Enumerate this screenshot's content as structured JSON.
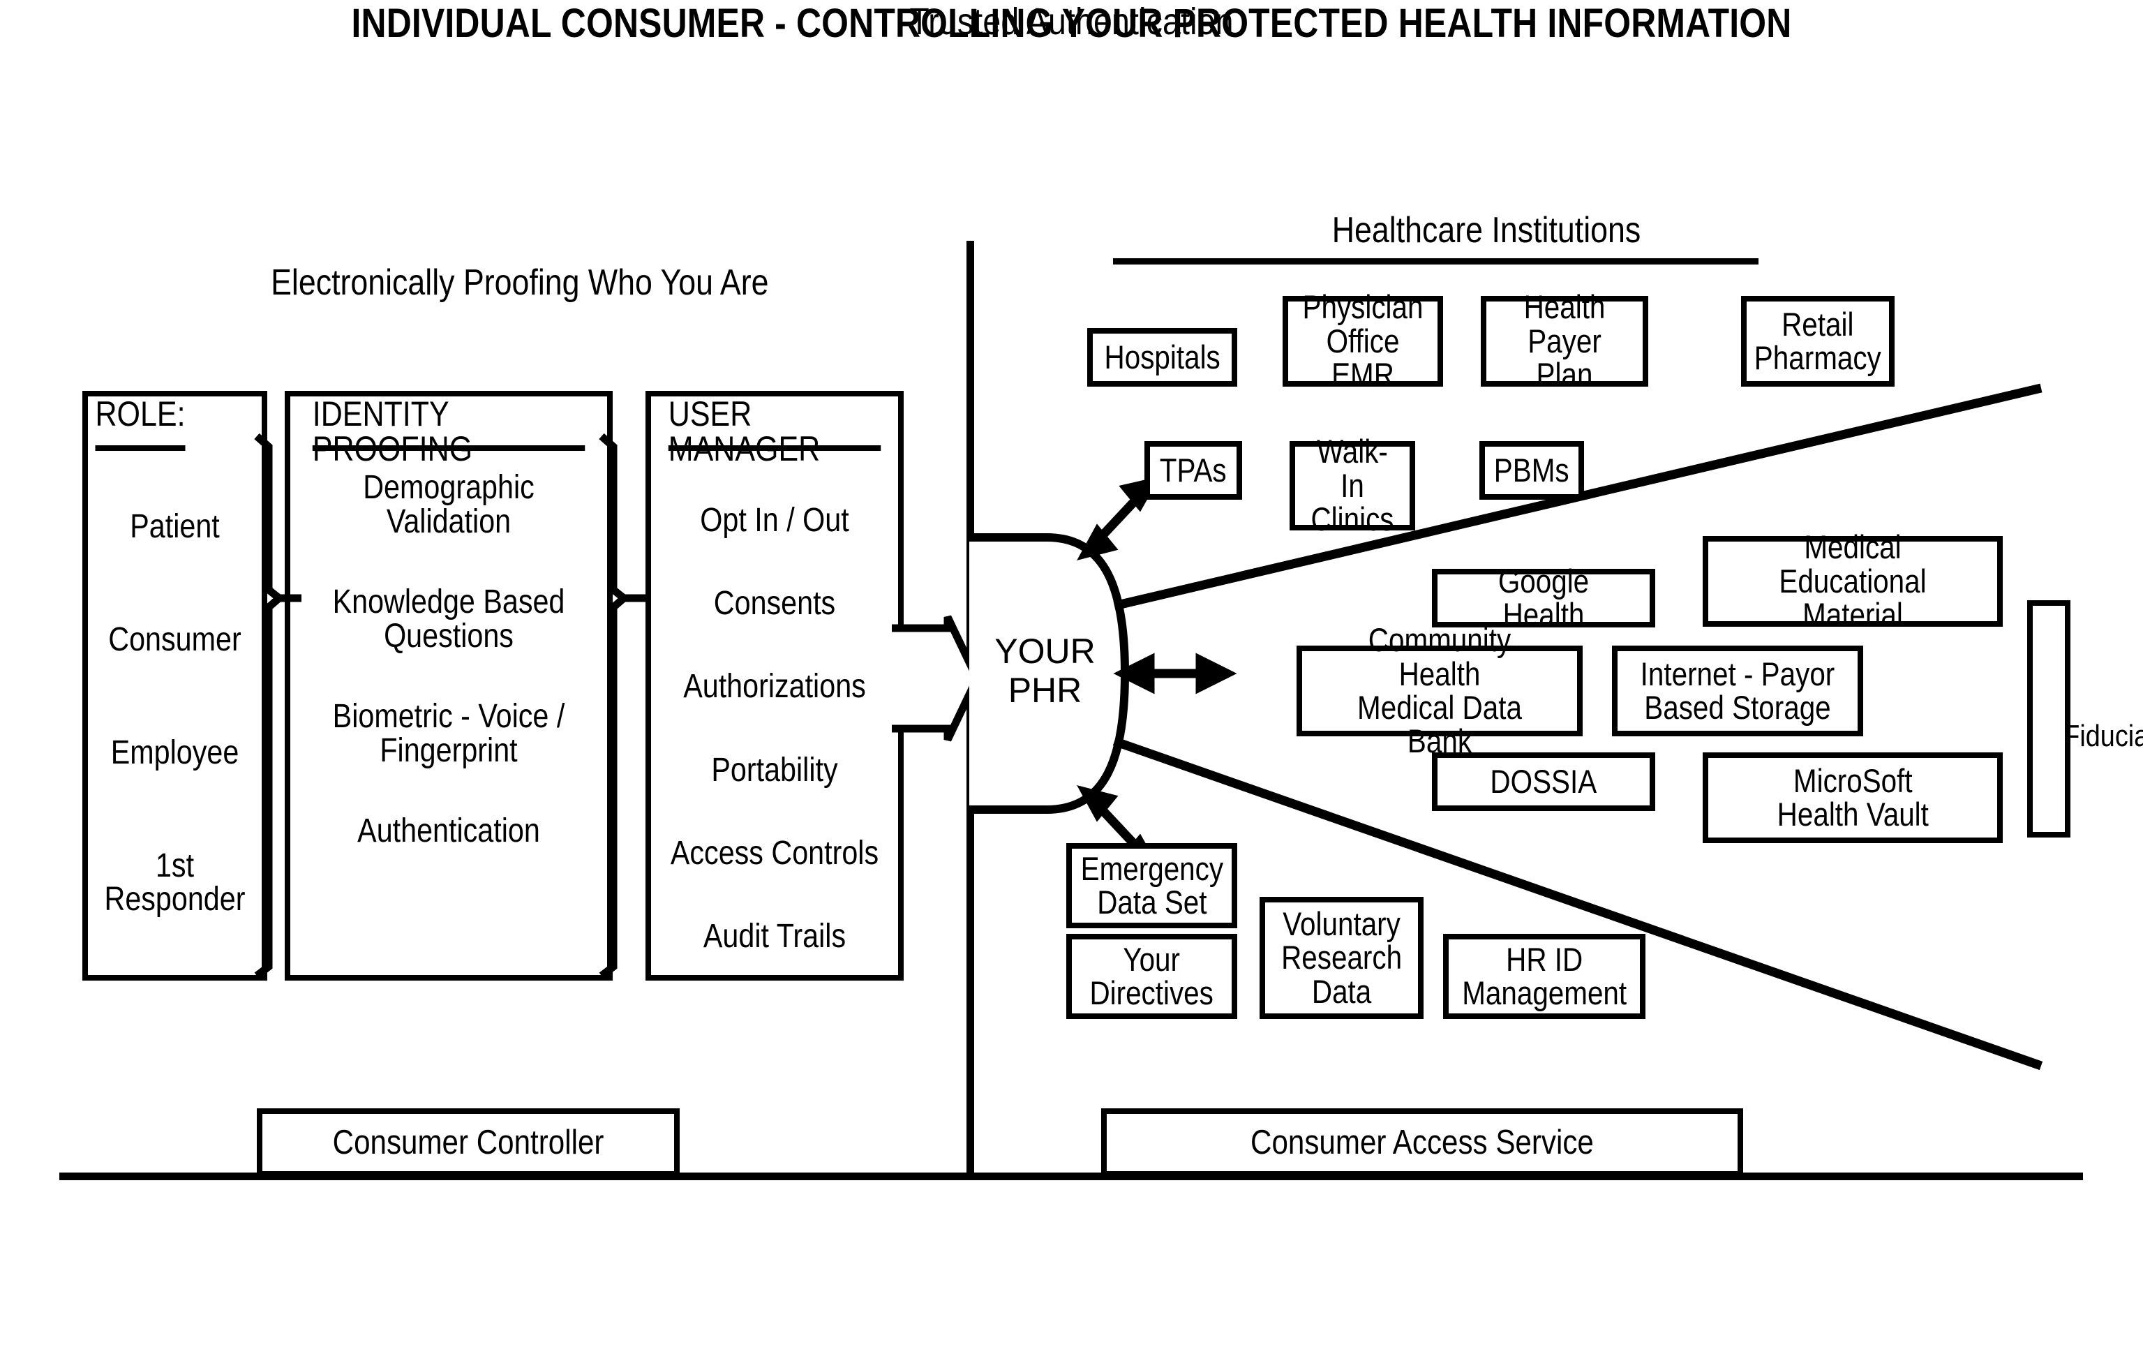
{
  "titles": {
    "subtitle": "Trusted Authentication",
    "main": "INDIVIDUAL CONSUMER - CONTROLLING YOUR PROTECTED HEALTH INFORMATION",
    "left_section": "Electronically Proofing Who You Are",
    "right_section": "Healthcare Institutions"
  },
  "colors": {
    "ink": "#000000",
    "paper": "#ffffff"
  },
  "panels": [
    {
      "header": "ROLE:",
      "items": [
        "Patient",
        "Consumer",
        "Employee",
        "1st\nResponder"
      ]
    },
    {
      "header": "IDENTITY PROOFING",
      "items": [
        "Demographic\nValidation",
        "Knowledge Based\nQuestions",
        "Biometric - Voice /\nFingerprint",
        "Authentication"
      ]
    },
    {
      "header": "USER MANAGER",
      "items": [
        "Opt In / Out",
        "Consents",
        "Authorizations",
        "Portability",
        "Access Controls",
        "Audit Trails"
      ]
    }
  ],
  "phr": {
    "line1": "YOUR",
    "line2": "PHR"
  },
  "institutions": [
    {
      "label": "Hospitals"
    },
    {
      "label": "Physician\nOffice EMR"
    },
    {
      "label": "Health Payer\nPlan"
    },
    {
      "label": "Retail\nPharmacy"
    },
    {
      "label": "TPAs"
    },
    {
      "label": "Walk-In\nClinics"
    },
    {
      "label": "PBMs"
    }
  ],
  "services": [
    {
      "label": "Google Health"
    },
    {
      "label": "Medical Educational\nMaterial"
    },
    {
      "label": "Community Health\nMedical Data Bank"
    },
    {
      "label": "Internet - Payor\nBased Storage"
    },
    {
      "label": "DOSSIA"
    },
    {
      "label": "MicroSoft\nHealth Vault"
    }
  ],
  "personal": [
    {
      "label": "Emergency\nData Set"
    },
    {
      "label": "Your\nDirectives"
    },
    {
      "label": "Voluntary\nResearch\nData"
    },
    {
      "label": "HR ID\nManagement"
    }
  ],
  "fiduciary_label": "Fiduciary Roles",
  "bottom_bars": [
    {
      "label": "Consumer Controller"
    },
    {
      "label": "Consumer Access Service"
    }
  ]
}
